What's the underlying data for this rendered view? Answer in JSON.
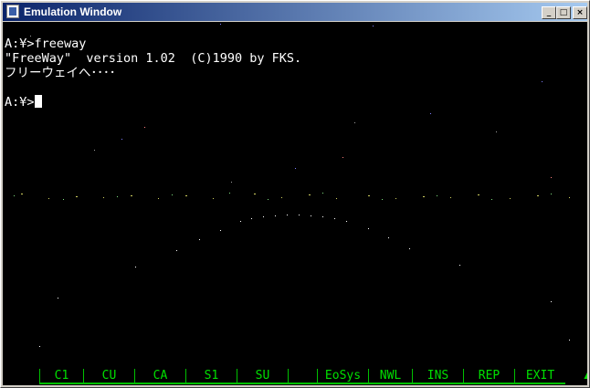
{
  "window": {
    "title": "Emulation Window",
    "icon": "terminal-app-icon",
    "controls": {
      "minimize": "_",
      "maximize": "□",
      "close": "×"
    }
  },
  "terminal": {
    "lines": [
      "A:¥>freeway",
      "\"FreeWay\"  version 1.02  (C)1990 by FKS.",
      "フリーウェイへ････",
      "",
      "A:¥>"
    ],
    "text_color": "#ffffff",
    "background": "#000000"
  },
  "function_keys": [
    "C1",
    "CU",
    "CA",
    "S1",
    "SU",
    "",
    "EoSys",
    "NWL",
    "INS",
    "REP",
    "EXIT"
  ],
  "function_key_color": "#00e000",
  "status_icon": "kana-lock-indicator-icon"
}
